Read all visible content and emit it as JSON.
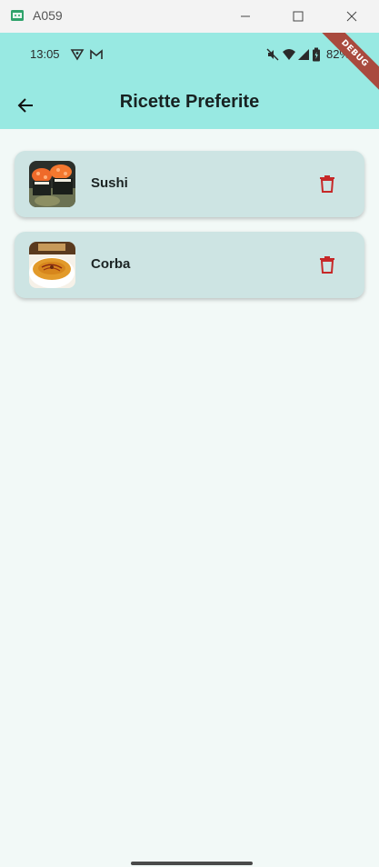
{
  "window": {
    "title": "A059",
    "icons": [
      "app-icon",
      "minimize-icon",
      "maximize-icon",
      "close-icon"
    ]
  },
  "status_bar": {
    "time": "13:05",
    "battery_percent": "82%",
    "icons": [
      "vpn-icon",
      "gmail-icon",
      "mute-icon",
      "wifi-icon",
      "signal-icon",
      "battery-icon"
    ]
  },
  "debug_banner": "DEBUG",
  "app_bar": {
    "title": "Ricette Preferite",
    "back_icon": "arrow-back-icon"
  },
  "favorites": [
    {
      "name": "Sushi",
      "image": "sushi-thumbnail",
      "action_icon": "delete-icon"
    },
    {
      "name": "Corba",
      "image": "corba-thumbnail",
      "action_icon": "delete-icon"
    }
  ],
  "colors": {
    "app_bar": "#98e9e2",
    "card": "#cde4e3",
    "background": "#f2f9f7",
    "delete": "#c62828",
    "debug_ribbon": "#a94a3e"
  }
}
